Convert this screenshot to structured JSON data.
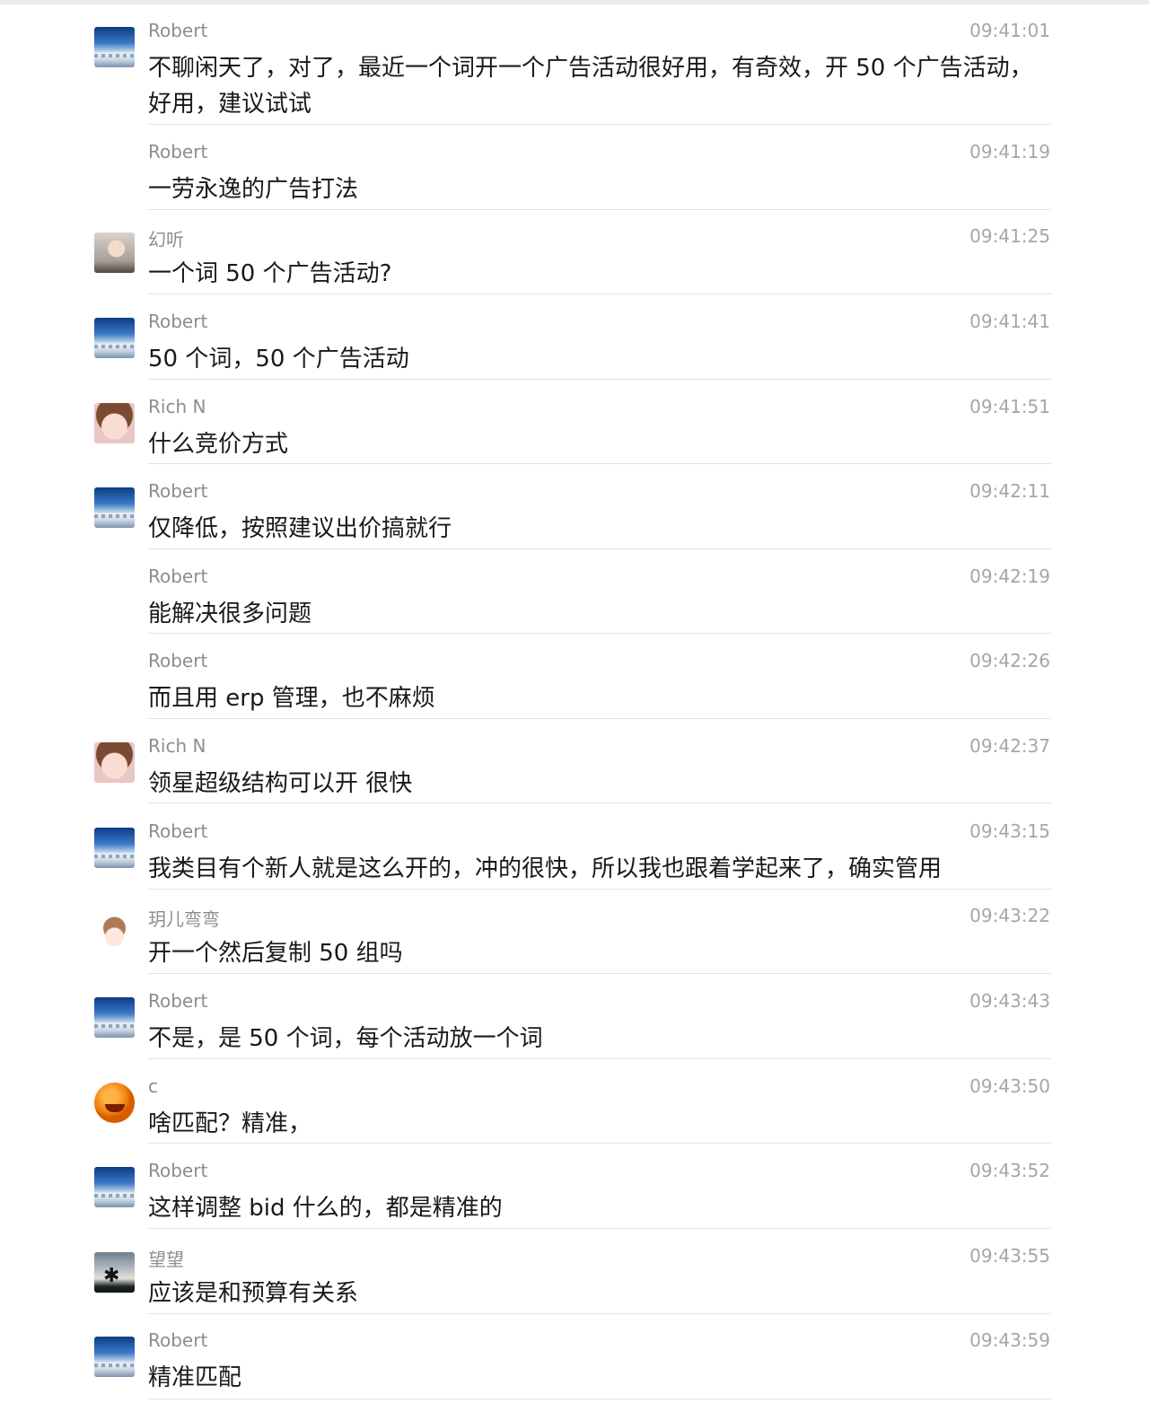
{
  "messages": [
    {
      "sender": "Robert",
      "time": "09:41:01",
      "text": "不聊闲天了，对了，最近一个词开一个广告活动很好用，有奇效，开 50 个广告活动，好用，建议试试",
      "avatar": "robert-avatar"
    },
    {
      "sender": "Robert",
      "time": "09:41:19",
      "text": "一劳永逸的广告打法",
      "avatar": null
    },
    {
      "sender": "幻听",
      "time": "09:41:25",
      "text": "一个词 50 个广告活动?",
      "avatar": "girl-avatar"
    },
    {
      "sender": "Robert",
      "time": "09:41:41",
      "text": "50 个词，50 个广告活动",
      "avatar": "robert-avatar"
    },
    {
      "sender": "Rich N",
      "time": "09:41:51",
      "text": "什么竞价方式",
      "avatar": "kid-avatar"
    },
    {
      "sender": "Robert",
      "time": "09:42:11",
      "text": "仅降低，按照建议出价搞就行",
      "avatar": "robert-avatar"
    },
    {
      "sender": "Robert",
      "time": "09:42:19",
      "text": "能解决很多问题",
      "avatar": null
    },
    {
      "sender": "Robert",
      "time": "09:42:26",
      "text": "而且用 erp 管理，也不麻烦",
      "avatar": null
    },
    {
      "sender": "Rich N",
      "time": "09:42:37",
      "text": "领星超级结构可以开 很快",
      "avatar": "kid-avatar"
    },
    {
      "sender": "Robert",
      "time": "09:43:15",
      "text": "我类目有个新人就是这么开的，冲的很快，所以我也跟着学起来了，确实管用",
      "avatar": "robert-avatar"
    },
    {
      "sender": "玥儿弯弯",
      "time": "09:43:22",
      "text": "开一个然后复制 50 组吗",
      "avatar": "doll-avatar"
    },
    {
      "sender": "Robert",
      "time": "09:43:43",
      "text": "不是，是 50 个词，每个活动放一个词",
      "avatar": "robert-avatar"
    },
    {
      "sender": "c",
      "time": "09:43:50",
      "text": "啥匹配？精准，",
      "avatar": "orange-avatar"
    },
    {
      "sender": "Robert",
      "time": "09:43:52",
      "text": "这样调整 bid 什么的，都是精准的",
      "avatar": "robert-avatar"
    },
    {
      "sender": "望望",
      "time": "09:43:55",
      "text": "应该是和预算有关系",
      "avatar": "palm-avatar"
    },
    {
      "sender": "Robert",
      "time": "09:43:59",
      "text": "精准匹配",
      "avatar": "robert-avatar"
    }
  ]
}
